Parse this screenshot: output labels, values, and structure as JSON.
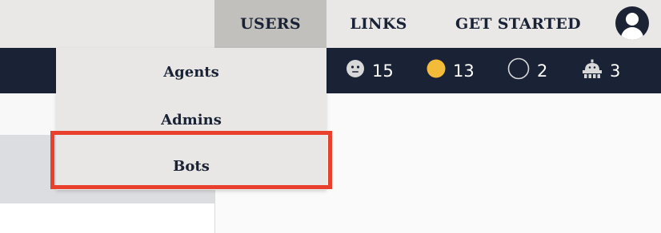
{
  "nav": {
    "items": [
      {
        "label": "USERS"
      },
      {
        "label": "LINKS"
      },
      {
        "label": "GET STARTED"
      }
    ],
    "active": "USERS"
  },
  "status": {
    "agents_count": "15",
    "online_count": "13",
    "offline_count": "2",
    "bots_count": "3"
  },
  "dropdown": {
    "items": [
      {
        "label": "Agents"
      },
      {
        "label": "Admins"
      },
      {
        "label": "Bots"
      }
    ],
    "highlighted": "Bots"
  },
  "colors": {
    "nav_bg": "#e9e8e6",
    "nav_active_bg": "#c1c0bd",
    "dark_bar": "#1a2235",
    "online_dot": "#f2bb3a",
    "highlight_border": "#e8402c"
  },
  "icons": {
    "agents": "face-icon",
    "online": "online-dot-icon",
    "offline": "offline-circle-icon",
    "bots": "robot-icon",
    "profile": "user-avatar-icon"
  }
}
